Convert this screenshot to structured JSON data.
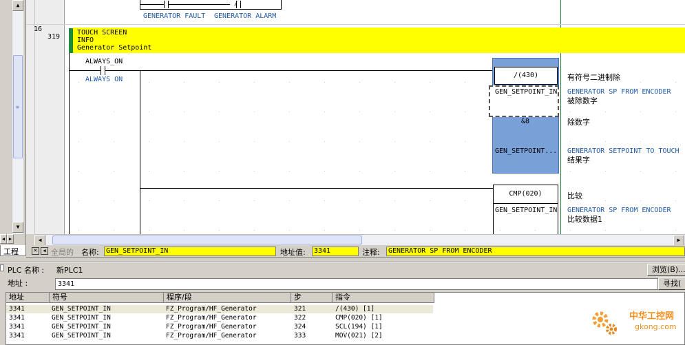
{
  "ladder": {
    "prev_rung": {
      "contact1": "GENERATOR FAULT",
      "contact2": "GENERATOR ALARM"
    },
    "rung16": {
      "rung_number": "16",
      "step_number": "319",
      "comment_lines": [
        "TOUCH SCREEN",
        "INFO",
        "Generator Setpoint"
      ],
      "contact_label": "ALWAYS_ON",
      "contact_comment": "ALWAYS ON",
      "div_instruction": {
        "mnemonic": "/(430)",
        "title": "有符号二进制除",
        "operand1": "GEN_SETPOINT_IN",
        "operand1_comment": "GENERATOR SP FROM ENCODER",
        "operand1_desc": "被除数字",
        "operand2": "&8",
        "operand2_desc": "除数字",
        "operand3": "GEN_SETPOINT...",
        "operand3_comment": "GENERATOR SETPOINT TO TOUCH",
        "operand3_desc": "结果字"
      },
      "cmp_instruction": {
        "mnemonic": "CMP(020)",
        "title": "比较",
        "operand1": "GEN_SETPOINT_IN",
        "operand1_comment": "GENERATOR SP FROM ENCODER",
        "operand1_desc": "比较数据1"
      }
    }
  },
  "left_panel": {
    "tab_label": "工程"
  },
  "infobar": {
    "global_label": "全局的",
    "name_label": "名称:",
    "name_value": "GEN_SETPOINT_IN",
    "address_label": "地址值:",
    "address_value": "3341",
    "comment_label": "注释:",
    "comment_value": "GENERATOR SP FROM ENCODER"
  },
  "xref": {
    "plc_label": "PLC 名称 :",
    "plc_value": "新PLC1",
    "address_label": "地址   :",
    "address_value": "3341",
    "browse_button": "浏览(B)...",
    "find_button": "寻找(",
    "columns": [
      "地址",
      "符号",
      "程序/段",
      "步",
      "指令"
    ],
    "rows": [
      {
        "address": "3341",
        "symbol": "GEN_SETPOINT_IN",
        "program": "FZ_Program/HF_Generator",
        "step": "321",
        "instruction": "/(430) [1]"
      },
      {
        "address": "3341",
        "symbol": "GEN_SETPOINT_IN",
        "program": "FZ_Program/HF_Generator",
        "step": "322",
        "instruction": "CMP(020) [1]"
      },
      {
        "address": "3341",
        "symbol": "GEN_SETPOINT_IN",
        "program": "FZ_Program/HF_Generator",
        "step": "324",
        "instruction": "SCL(194) [1]"
      },
      {
        "address": "3341",
        "symbol": "GEN_SETPOINT_IN",
        "program": "FZ_Program/HF_Generator",
        "step": "333",
        "instruction": "MOV(021) [2]"
      }
    ]
  },
  "watermark": {
    "brand": "中华工控网",
    "domain": "gkong.com"
  },
  "colors": {
    "comment_bg": "#ffff00",
    "rung_bar": "#1e8a3c",
    "selection": "#7aa0d8",
    "symbol_comment": "#1e5aa8"
  }
}
